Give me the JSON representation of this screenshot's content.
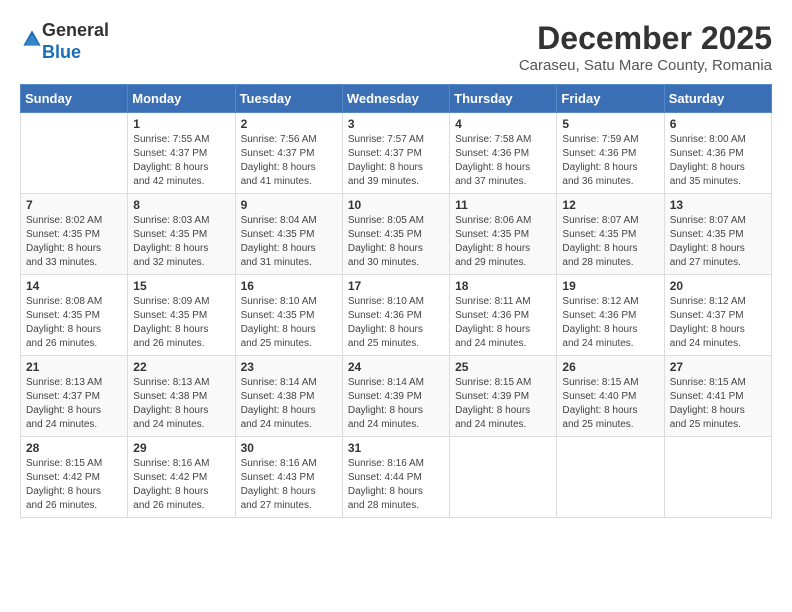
{
  "logo": {
    "general": "General",
    "blue": "Blue"
  },
  "title": "December 2025",
  "location": "Caraseu, Satu Mare County, Romania",
  "weekdays": [
    "Sunday",
    "Monday",
    "Tuesday",
    "Wednesday",
    "Thursday",
    "Friday",
    "Saturday"
  ],
  "weeks": [
    [
      {
        "day": "",
        "info": ""
      },
      {
        "day": "1",
        "info": "Sunrise: 7:55 AM\nSunset: 4:37 PM\nDaylight: 8 hours\nand 42 minutes."
      },
      {
        "day": "2",
        "info": "Sunrise: 7:56 AM\nSunset: 4:37 PM\nDaylight: 8 hours\nand 41 minutes."
      },
      {
        "day": "3",
        "info": "Sunrise: 7:57 AM\nSunset: 4:37 PM\nDaylight: 8 hours\nand 39 minutes."
      },
      {
        "day": "4",
        "info": "Sunrise: 7:58 AM\nSunset: 4:36 PM\nDaylight: 8 hours\nand 37 minutes."
      },
      {
        "day": "5",
        "info": "Sunrise: 7:59 AM\nSunset: 4:36 PM\nDaylight: 8 hours\nand 36 minutes."
      },
      {
        "day": "6",
        "info": "Sunrise: 8:00 AM\nSunset: 4:36 PM\nDaylight: 8 hours\nand 35 minutes."
      }
    ],
    [
      {
        "day": "7",
        "info": "Sunrise: 8:02 AM\nSunset: 4:35 PM\nDaylight: 8 hours\nand 33 minutes."
      },
      {
        "day": "8",
        "info": "Sunrise: 8:03 AM\nSunset: 4:35 PM\nDaylight: 8 hours\nand 32 minutes."
      },
      {
        "day": "9",
        "info": "Sunrise: 8:04 AM\nSunset: 4:35 PM\nDaylight: 8 hours\nand 31 minutes."
      },
      {
        "day": "10",
        "info": "Sunrise: 8:05 AM\nSunset: 4:35 PM\nDaylight: 8 hours\nand 30 minutes."
      },
      {
        "day": "11",
        "info": "Sunrise: 8:06 AM\nSunset: 4:35 PM\nDaylight: 8 hours\nand 29 minutes."
      },
      {
        "day": "12",
        "info": "Sunrise: 8:07 AM\nSunset: 4:35 PM\nDaylight: 8 hours\nand 28 minutes."
      },
      {
        "day": "13",
        "info": "Sunrise: 8:07 AM\nSunset: 4:35 PM\nDaylight: 8 hours\nand 27 minutes."
      }
    ],
    [
      {
        "day": "14",
        "info": "Sunrise: 8:08 AM\nSunset: 4:35 PM\nDaylight: 8 hours\nand 26 minutes."
      },
      {
        "day": "15",
        "info": "Sunrise: 8:09 AM\nSunset: 4:35 PM\nDaylight: 8 hours\nand 26 minutes."
      },
      {
        "day": "16",
        "info": "Sunrise: 8:10 AM\nSunset: 4:35 PM\nDaylight: 8 hours\nand 25 minutes."
      },
      {
        "day": "17",
        "info": "Sunrise: 8:10 AM\nSunset: 4:36 PM\nDaylight: 8 hours\nand 25 minutes."
      },
      {
        "day": "18",
        "info": "Sunrise: 8:11 AM\nSunset: 4:36 PM\nDaylight: 8 hours\nand 24 minutes."
      },
      {
        "day": "19",
        "info": "Sunrise: 8:12 AM\nSunset: 4:36 PM\nDaylight: 8 hours\nand 24 minutes."
      },
      {
        "day": "20",
        "info": "Sunrise: 8:12 AM\nSunset: 4:37 PM\nDaylight: 8 hours\nand 24 minutes."
      }
    ],
    [
      {
        "day": "21",
        "info": "Sunrise: 8:13 AM\nSunset: 4:37 PM\nDaylight: 8 hours\nand 24 minutes."
      },
      {
        "day": "22",
        "info": "Sunrise: 8:13 AM\nSunset: 4:38 PM\nDaylight: 8 hours\nand 24 minutes."
      },
      {
        "day": "23",
        "info": "Sunrise: 8:14 AM\nSunset: 4:38 PM\nDaylight: 8 hours\nand 24 minutes."
      },
      {
        "day": "24",
        "info": "Sunrise: 8:14 AM\nSunset: 4:39 PM\nDaylight: 8 hours\nand 24 minutes."
      },
      {
        "day": "25",
        "info": "Sunrise: 8:15 AM\nSunset: 4:39 PM\nDaylight: 8 hours\nand 24 minutes."
      },
      {
        "day": "26",
        "info": "Sunrise: 8:15 AM\nSunset: 4:40 PM\nDaylight: 8 hours\nand 25 minutes."
      },
      {
        "day": "27",
        "info": "Sunrise: 8:15 AM\nSunset: 4:41 PM\nDaylight: 8 hours\nand 25 minutes."
      }
    ],
    [
      {
        "day": "28",
        "info": "Sunrise: 8:15 AM\nSunset: 4:42 PM\nDaylight: 8 hours\nand 26 minutes."
      },
      {
        "day": "29",
        "info": "Sunrise: 8:16 AM\nSunset: 4:42 PM\nDaylight: 8 hours\nand 26 minutes."
      },
      {
        "day": "30",
        "info": "Sunrise: 8:16 AM\nSunset: 4:43 PM\nDaylight: 8 hours\nand 27 minutes."
      },
      {
        "day": "31",
        "info": "Sunrise: 8:16 AM\nSunset: 4:44 PM\nDaylight: 8 hours\nand 28 minutes."
      },
      {
        "day": "",
        "info": ""
      },
      {
        "day": "",
        "info": ""
      },
      {
        "day": "",
        "info": ""
      }
    ]
  ]
}
